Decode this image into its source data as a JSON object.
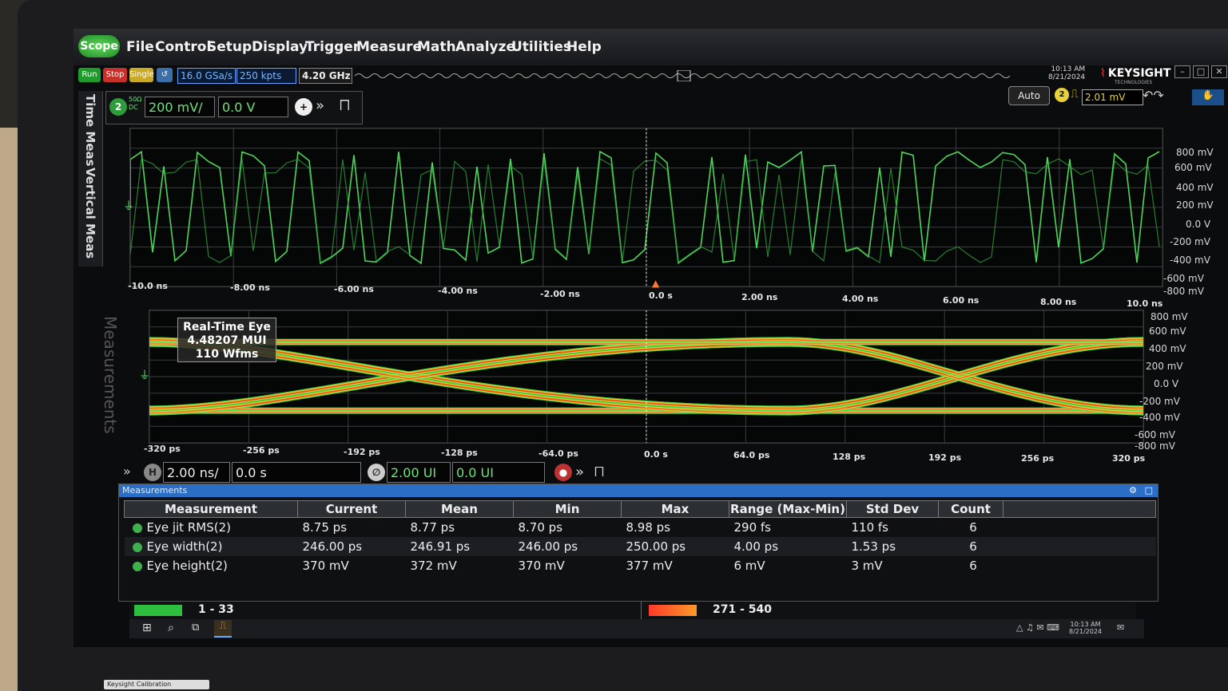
{
  "menubar": {
    "scope_label": "Scope",
    "items": [
      "File",
      "Control",
      "Setup",
      "Display",
      "Trigger",
      "Measure",
      "Math",
      "Analyze",
      "Utilities",
      "Help"
    ],
    "clock_time": "10:13 AM",
    "clock_date": "8/21/2024",
    "brand": "KEYSIGHT",
    "brand_sub": "TECHNOLOGIES"
  },
  "acquisition": {
    "run": "Run",
    "stop": "Stop",
    "single": "Single",
    "sample_rate": "16.0 GSa/s",
    "memory_depth": "250 kpts",
    "bandwidth": "4.20 GHz"
  },
  "channel": {
    "number": "2",
    "impedance": "50Ω",
    "coupling": "DC",
    "scale": "200 mV/",
    "offset": "0.0 V"
  },
  "trigger": {
    "mode": "Auto",
    "channel": "2",
    "level": "2.01 mV"
  },
  "side_tabs": [
    "Time Meas",
    "Vertical Meas"
  ],
  "waveform": {
    "x_ticks": [
      "-10.0 ns",
      "-8.00 ns",
      "-6.00 ns",
      "-4.00 ns",
      "-2.00 ns",
      "0.0 s",
      "2.00 ns",
      "4.00 ns",
      "6.00 ns",
      "8.00 ns",
      "10.0 ns"
    ],
    "y_ticks": [
      "800 mV",
      "600 mV",
      "400 mV",
      "200 mV",
      "0.0 V",
      "-200 mV",
      "-400 mV",
      "-600 mV",
      "-800 mV"
    ]
  },
  "eye": {
    "label_title": "Real-Time Eye",
    "label_mui": "4.48207 MUI",
    "label_wfms": "110 Wfms",
    "measurements_tab": "Measurements",
    "x_ticks": [
      "-320 ps",
      "-256 ps",
      "-192 ps",
      "-128 ps",
      "-64.0 ps",
      "0.0 s",
      "64.0 ps",
      "128 ps",
      "192 ps",
      "256 ps",
      "320 ps"
    ],
    "y_ticks": [
      "800 mV",
      "600 mV",
      "400 mV",
      "200 mV",
      "0.0 V",
      "-200 mV",
      "-400 mV",
      "-600 mV",
      "-800 mV"
    ]
  },
  "timebase": {
    "scale": "2.00 ns/",
    "position": "0.0 s",
    "ui_scale": "2.00 UI",
    "ui_position": "0.0 UI"
  },
  "measurements": {
    "panel_title": "Measurements",
    "columns": [
      "Measurement",
      "Current",
      "Mean",
      "Min",
      "Max",
      "Range (Max-Min)",
      "Std Dev",
      "Count"
    ],
    "rows": [
      {
        "name": "Eye jit RMS(2)",
        "current": "8.75 ps",
        "mean": "8.77 ps",
        "min": "8.70 ps",
        "max": "8.98 ps",
        "range": "290 fs",
        "std": "110 fs",
        "count": "6"
      },
      {
        "name": "Eye width(2)",
        "current": "246.00 ps",
        "mean": "246.91 ps",
        "min": "246.00 ps",
        "max": "250.00 ps",
        "range": "4.00 ps",
        "std": "1.53 ps",
        "count": "6"
      },
      {
        "name": "Eye height(2)",
        "current": "370 mV",
        "mean": "372 mV",
        "min": "370 mV",
        "max": "377 mV",
        "range": "6 mV",
        "std": "3 mV",
        "count": "6"
      }
    ]
  },
  "status": {
    "left_range": "1 - 33",
    "right_range": "271 - 540"
  },
  "taskbar": {
    "time": "10:13 AM",
    "date": "8/21/2024"
  },
  "calibration_label": "Keysight Calibration",
  "colors": {
    "waveform": "#4fd65a",
    "eye_hot": "#ff3a2a",
    "eye_mid": "#ffe82a",
    "eye_cool": "#3fe04a",
    "accent_blue": "#2b6ec6"
  }
}
